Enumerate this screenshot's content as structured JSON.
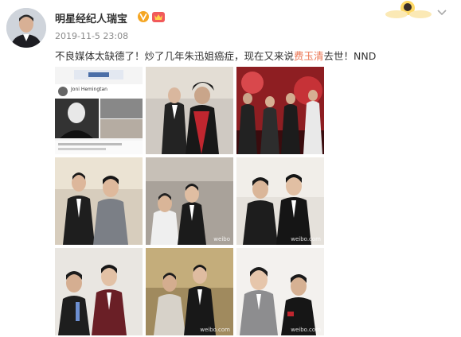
{
  "post": {
    "author": "明星经纪人瑞宝",
    "timestamp": "2019-11-5 23:08",
    "text_before": "不良媒体太缺德了！炒了几年朱迅姐癌症，现在又来说",
    "highlight": "费玉清",
    "text_after": "去世！NND"
  },
  "icons": {
    "verified_badge": "v-verified-icon",
    "member_badge": "member-crown-icon",
    "card_decoration": "sun-cloud-card-icon",
    "menu": "chevron-down-icon"
  },
  "colors": {
    "highlight": "#eb7350",
    "verified": "#f5a623",
    "text": "#333333",
    "muted": "#8a8a8a"
  },
  "photos": {
    "p1": {
      "heading": "Joni Hemingtan",
      "watermark": ""
    },
    "p4": {
      "watermark": ""
    },
    "p5": {
      "watermark": "weibo"
    },
    "p6": {
      "watermark": "weibo.com"
    },
    "p8": {
      "watermark": "weibo.com"
    },
    "p9": {
      "watermark": "weibo.com"
    }
  }
}
